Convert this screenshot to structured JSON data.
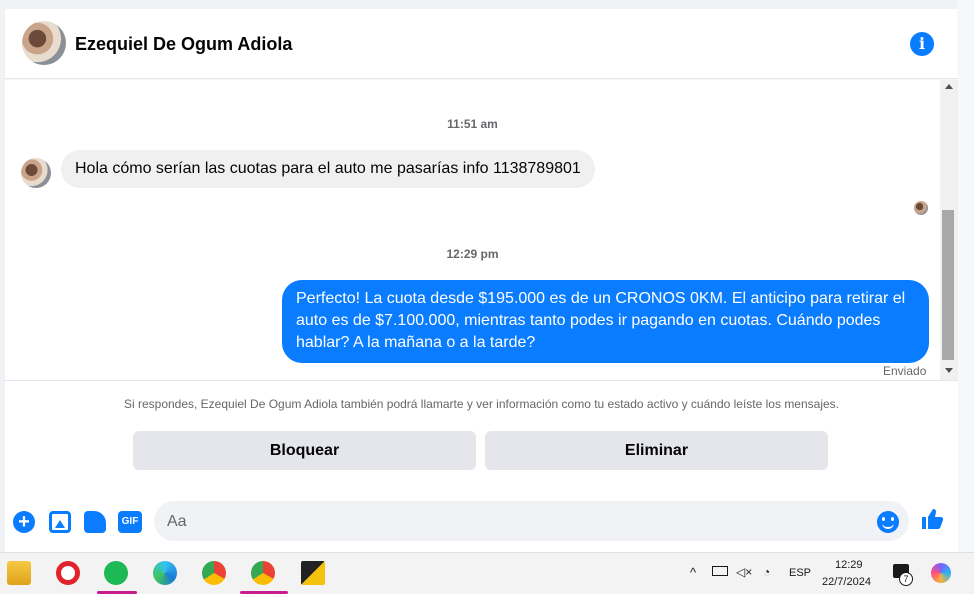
{
  "header": {
    "contact_name": "Ezequiel De Ogum Adiola",
    "info_icon": "info-icon"
  },
  "thread": {
    "messages": [
      {
        "timestamp": "11:51 am"
      },
      {
        "direction": "incoming",
        "text": "Hola cómo serían las cuotas para el auto me pasarías info 1138789801"
      },
      {
        "timestamp": "12:29 pm"
      },
      {
        "direction": "outgoing",
        "text": "Perfecto! La cuota desde $195.000 es de un CRONOS 0KM. El anticipo para retirar el auto es de $7.100.000, mientras tanto podes ir pagando en cuotas. Cuándo podes hablar? A la mañana o a la tarde?",
        "status": "Enviado"
      }
    ]
  },
  "notice": {
    "text": "Si respondes, Ezequiel De Ogum Adiola también podrá llamarte y ver información como tu estado activo y cuándo leíste los mensajes.",
    "block_label": "Bloquear",
    "delete_label": "Eliminar"
  },
  "composer": {
    "placeholder": "Aa",
    "gif_label": "GIF"
  },
  "taskbar": {
    "language": "ESP",
    "time": "12:29",
    "date": "22/7/2024",
    "notification_count": "7"
  },
  "colors": {
    "accent": "#0a7cff",
    "bubble_in": "#f0f0f0",
    "secondary_text": "#65676b"
  }
}
